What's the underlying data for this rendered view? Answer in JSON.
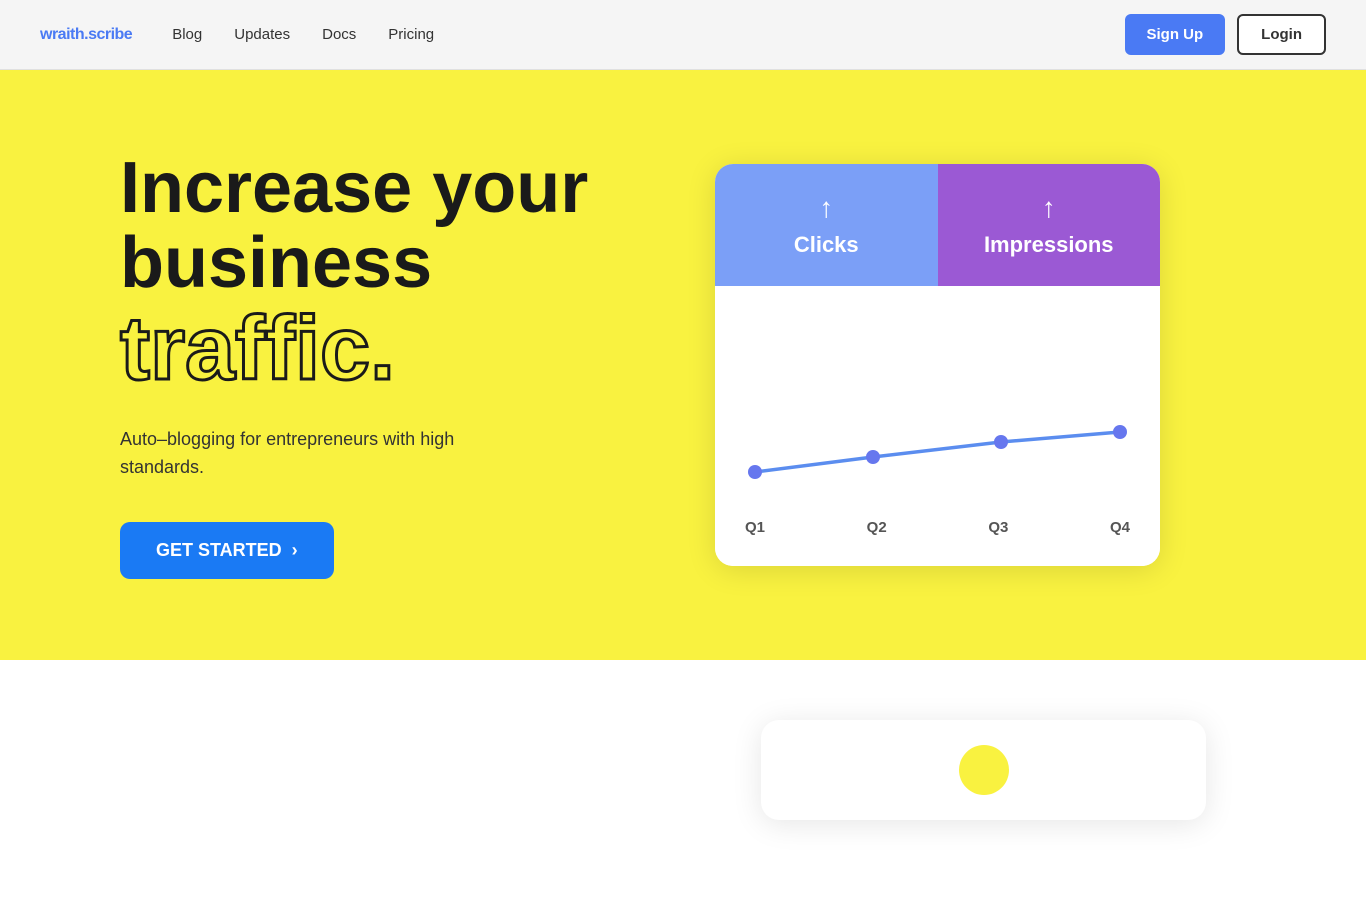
{
  "nav": {
    "logo_text": "wraith.scribe",
    "links": [
      {
        "label": "Blog",
        "href": "#"
      },
      {
        "label": "Updates",
        "href": "#"
      },
      {
        "label": "Docs",
        "href": "#"
      },
      {
        "label": "Pricing",
        "href": "#"
      }
    ],
    "signup_label": "Sign Up",
    "login_label": "Login"
  },
  "hero": {
    "title_line1": "Increase your",
    "title_line2": "business",
    "title_line3": "traffic.",
    "subtitle": "Auto–blogging for entrepreneurs with high standards.",
    "cta_label": "GET STARTED"
  },
  "chart": {
    "tab_clicks": "Clicks",
    "tab_impressions": "Impressions",
    "arrow_up": "↑",
    "x_labels": [
      "Q1",
      "Q2",
      "Q3",
      "Q4"
    ]
  },
  "colors": {
    "yellow": "#f9f240",
    "blue_tab": "#7b9ff7",
    "purple_tab": "#9b59d4",
    "blue_btn": "#1a7af4",
    "line_color": "#5b8def",
    "dot_color": "#6677ee"
  }
}
